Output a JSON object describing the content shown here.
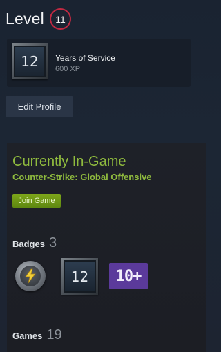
{
  "level": {
    "label": "Level",
    "value": "11"
  },
  "service_badge": {
    "number": "12",
    "title": "Years of Service",
    "xp": "600 XP"
  },
  "edit_profile": {
    "label": "Edit Profile"
  },
  "in_game": {
    "status": "Currently In-Game",
    "game": "Counter-Strike: Global Offensive",
    "join_label": "Join Game"
  },
  "badges": {
    "label": "Badges",
    "count": "3",
    "items": [
      {
        "icon": "lightning-badge-icon"
      },
      {
        "icon": "years-of-service-badge-icon",
        "text": "12"
      },
      {
        "icon": "games-owned-badge-icon",
        "text": "10+"
      }
    ]
  },
  "games": {
    "label": "Games",
    "count": "19"
  },
  "colors": {
    "level_ring": "#c02942",
    "in_game_green": "#8fba3e",
    "join_button": "#6d9716"
  }
}
